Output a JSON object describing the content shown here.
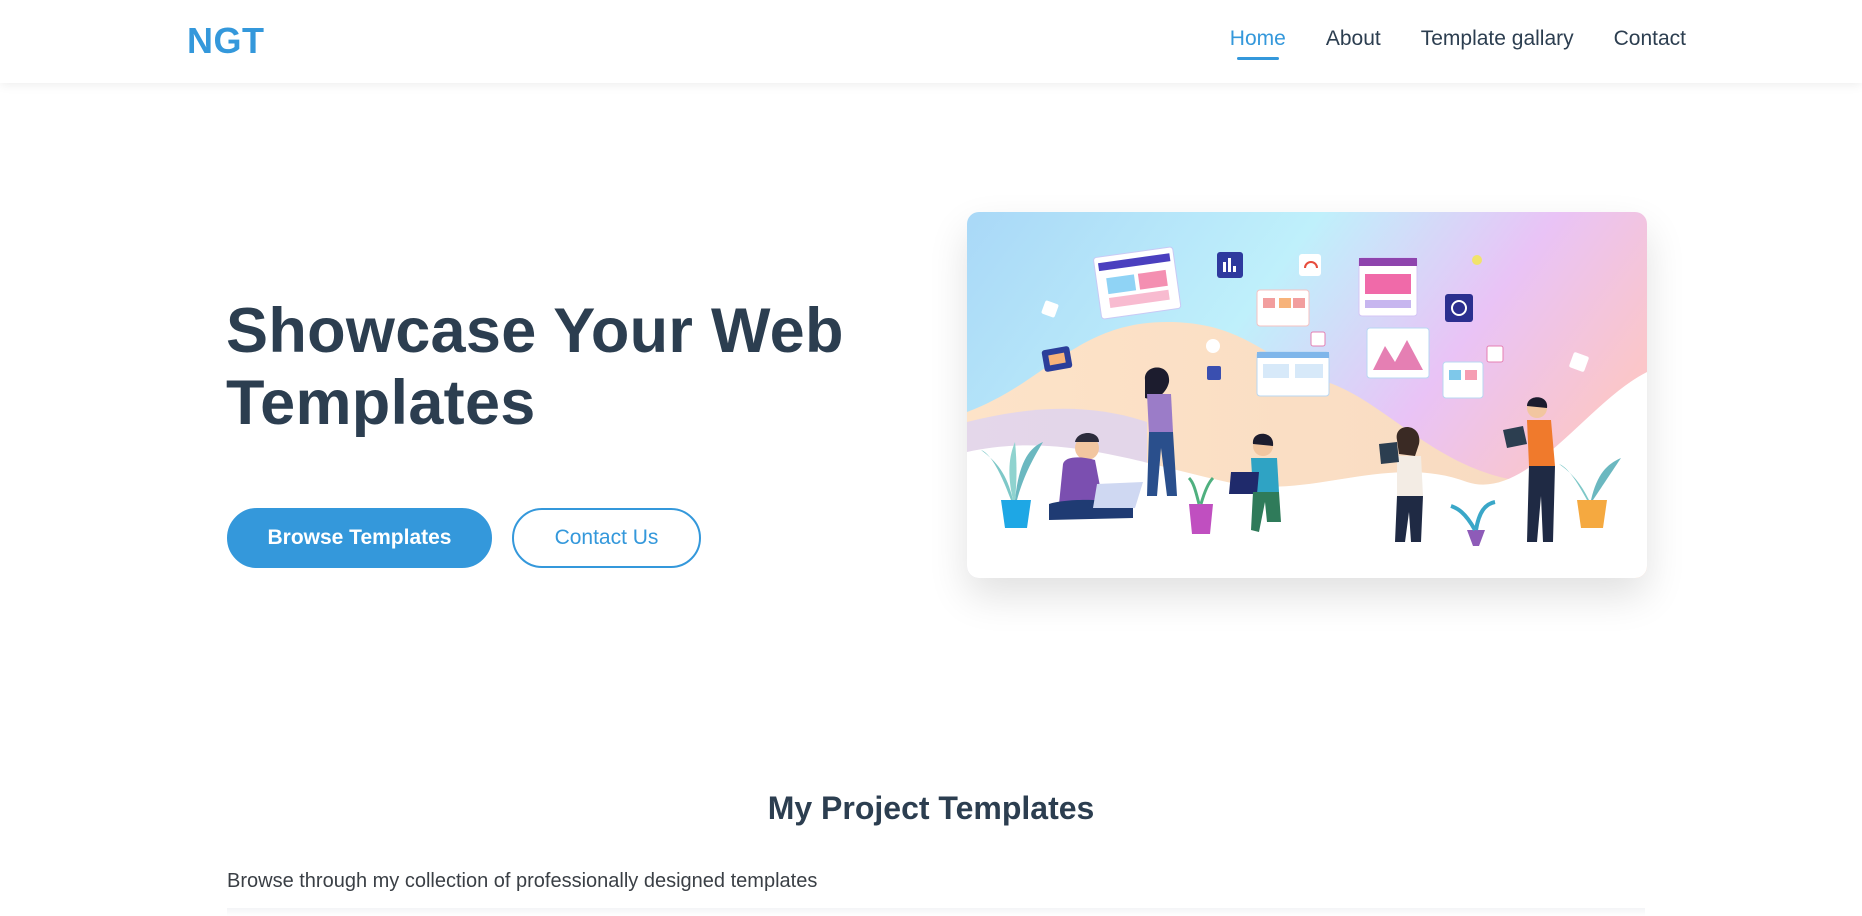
{
  "header": {
    "logo": "NGT",
    "nav": [
      {
        "label": "Home",
        "active": true
      },
      {
        "label": "About",
        "active": false
      },
      {
        "label": "Template gallary",
        "active": false
      },
      {
        "label": "Contact",
        "active": false
      }
    ]
  },
  "hero": {
    "title_line1": "Showcase Your Web",
    "title_line2": "Templates",
    "primary_button": "Browse Templates",
    "secondary_button": "Contact Us",
    "illustration": "team-collaboration-illustration"
  },
  "section": {
    "title": "My Project Templates",
    "subtitle": "Browse through my collection of professionally designed templates"
  },
  "colors": {
    "accent": "#3498db",
    "text_dark": "#2c3e50",
    "background": "#ffffff"
  }
}
